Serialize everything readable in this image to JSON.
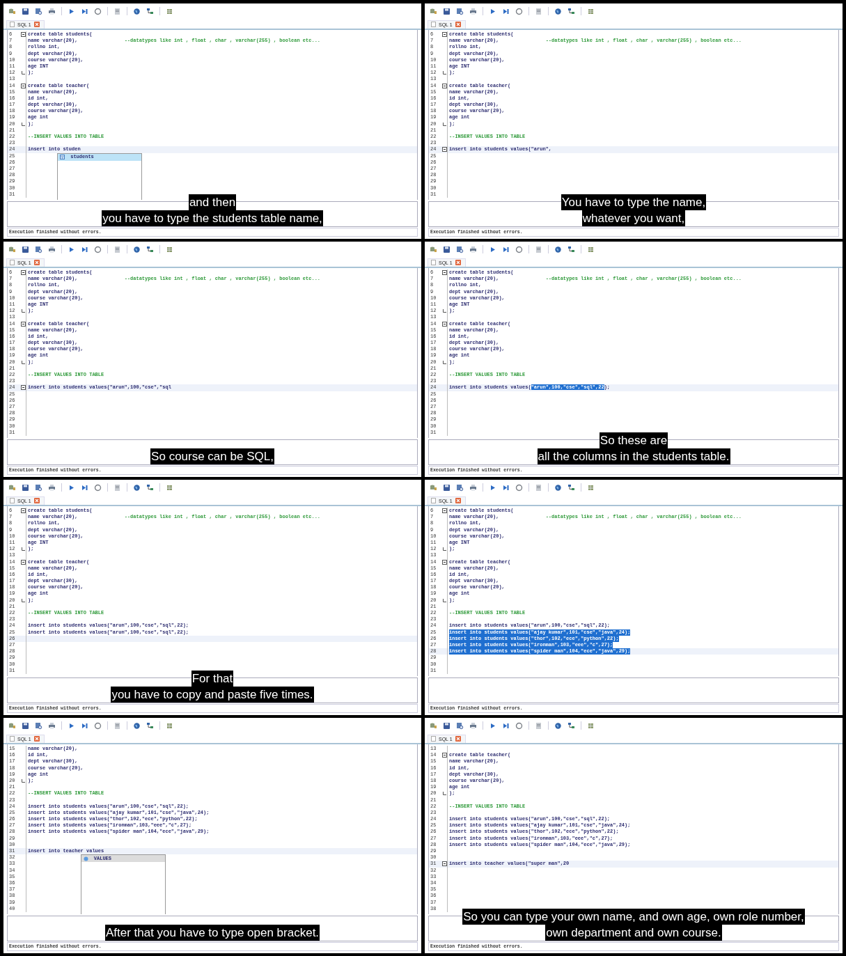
{
  "frames": [
    {
      "tab": {
        "label": "SQL 1",
        "selected": true
      },
      "lines": [
        {
          "no": "6",
          "kind": "code",
          "text": "create table students(",
          "fold_start": true
        },
        {
          "no": "7",
          "kind": "code",
          "text": "name varchar(20),",
          "comment": "--datatypes like int , float , char , varchar(255) , boolean etc..."
        },
        {
          "no": "8",
          "kind": "code",
          "text": "rollno int,"
        },
        {
          "no": "9",
          "kind": "code",
          "text": "dept varchar(20),"
        },
        {
          "no": "10",
          "kind": "code",
          "text": "course varchar(20),"
        },
        {
          "no": "11",
          "kind": "code",
          "text": "age INT"
        },
        {
          "no": "12",
          "kind": "code",
          "text": ");",
          "fold_end": true
        },
        {
          "no": "13"
        },
        {
          "no": "14",
          "kind": "code",
          "text": "create table teacher(",
          "fold_start": true
        },
        {
          "no": "15",
          "kind": "code",
          "text": "name varchar(20),"
        },
        {
          "no": "16",
          "kind": "code",
          "text": "id int,"
        },
        {
          "no": "17",
          "kind": "code",
          "text": "dept varchar(30),"
        },
        {
          "no": "18",
          "kind": "code",
          "text": "course varchar(20),"
        },
        {
          "no": "19",
          "kind": "code",
          "text": "age int"
        },
        {
          "no": "20",
          "kind": "code",
          "text": ");",
          "fold_end": true
        },
        {
          "no": "21"
        },
        {
          "no": "22",
          "kind": "comment",
          "text": "--INSERT VALUES INTO TABLE"
        },
        {
          "no": "23"
        },
        {
          "no": "24",
          "kind": "code",
          "text": "insert into studen",
          "current": true,
          "popup": {
            "items": [
              {
                "label": "students",
                "kind": "table",
                "selected": true
              }
            ]
          }
        },
        {
          "no": "25"
        },
        {
          "no": "26"
        },
        {
          "no": "27"
        },
        {
          "no": "28"
        },
        {
          "no": "29"
        },
        {
          "no": "30"
        },
        {
          "no": "31"
        }
      ],
      "subtitle": [
        "and then",
        "you have to type the students table name,"
      ],
      "status": "Execution finished without errors."
    },
    {
      "tab": {
        "label": "SQL 1",
        "selected": true
      },
      "lines": [
        {
          "no": "6",
          "kind": "code",
          "text": "create table students(",
          "fold_start": true
        },
        {
          "no": "7",
          "kind": "code",
          "text": "name varchar(20),",
          "comment": "--datatypes like int , float , char , varchar(255) , boolean etc..."
        },
        {
          "no": "8",
          "kind": "code",
          "text": "rollno int,"
        },
        {
          "no": "9",
          "kind": "code",
          "text": "dept varchar(20),"
        },
        {
          "no": "10",
          "kind": "code",
          "text": "course varchar(20),"
        },
        {
          "no": "11",
          "kind": "code",
          "text": "age INT"
        },
        {
          "no": "12",
          "kind": "code",
          "text": ");",
          "fold_end": true
        },
        {
          "no": "13"
        },
        {
          "no": "14",
          "kind": "code",
          "text": "create table teacher(",
          "fold_start": true
        },
        {
          "no": "15",
          "kind": "code",
          "text": "name varchar(20),"
        },
        {
          "no": "16",
          "kind": "code",
          "text": "id int,"
        },
        {
          "no": "17",
          "kind": "code",
          "text": "dept varchar(30),"
        },
        {
          "no": "18",
          "kind": "code",
          "text": "course varchar(20),"
        },
        {
          "no": "19",
          "kind": "code",
          "text": "age int"
        },
        {
          "no": "20",
          "kind": "code",
          "text": ");",
          "fold_end": true
        },
        {
          "no": "21"
        },
        {
          "no": "22",
          "kind": "comment",
          "text": "--INSERT VALUES INTO TABLE"
        },
        {
          "no": "23"
        },
        {
          "no": "24",
          "kind": "code",
          "text": "insert into students values(\"arun\",",
          "fold_start": true,
          "current": true
        },
        {
          "no": "25"
        },
        {
          "no": "26"
        },
        {
          "no": "27"
        },
        {
          "no": "28"
        },
        {
          "no": "29"
        },
        {
          "no": "30"
        },
        {
          "no": "31"
        }
      ],
      "subtitle": [
        "You have to type the name,",
        "whatever you want,"
      ],
      "status": "Execution finished without errors."
    },
    {
      "tab": {
        "label": "SQL 1",
        "selected": true
      },
      "lines": [
        {
          "no": "6",
          "kind": "code",
          "text": "create table students(",
          "fold_start": true
        },
        {
          "no": "7",
          "kind": "code",
          "text": "name varchar(20),",
          "comment": "--datatypes like int , float , char , varchar(255) , boolean etc..."
        },
        {
          "no": "8",
          "kind": "code",
          "text": "rollno int,"
        },
        {
          "no": "9",
          "kind": "code",
          "text": "dept varchar(20),"
        },
        {
          "no": "10",
          "kind": "code",
          "text": "course varchar(20),"
        },
        {
          "no": "11",
          "kind": "code",
          "text": "age INT"
        },
        {
          "no": "12",
          "kind": "code",
          "text": ");",
          "fold_end": true
        },
        {
          "no": "13"
        },
        {
          "no": "14",
          "kind": "code",
          "text": "create table teacher(",
          "fold_start": true
        },
        {
          "no": "15",
          "kind": "code",
          "text": "name varchar(20),"
        },
        {
          "no": "16",
          "kind": "code",
          "text": "id int,"
        },
        {
          "no": "17",
          "kind": "code",
          "text": "dept varchar(30),"
        },
        {
          "no": "18",
          "kind": "code",
          "text": "course varchar(20),"
        },
        {
          "no": "19",
          "kind": "code",
          "text": "age int"
        },
        {
          "no": "20",
          "kind": "code",
          "text": ");",
          "fold_end": true
        },
        {
          "no": "21"
        },
        {
          "no": "22",
          "kind": "comment",
          "text": "--INSERT VALUES INTO TABLE"
        },
        {
          "no": "23"
        },
        {
          "no": "24",
          "kind": "code",
          "text": "insert into students values(\"arun\",100,\"cse\",\"sql",
          "fold_start": true,
          "current": true
        },
        {
          "no": "25"
        },
        {
          "no": "26"
        },
        {
          "no": "27"
        },
        {
          "no": "28"
        },
        {
          "no": "29"
        },
        {
          "no": "30"
        },
        {
          "no": "31"
        }
      ],
      "subtitle": [
        "So course can be SQL,"
      ],
      "status": "Execution finished without errors."
    },
    {
      "tab": {
        "label": "SQL 1",
        "selected": true
      },
      "lines": [
        {
          "no": "6",
          "kind": "code",
          "text": "create table students(",
          "fold_start": true
        },
        {
          "no": "7",
          "kind": "code",
          "text": "name varchar(20),",
          "comment": "--datatypes like int , float , char , varchar(255) , boolean etc..."
        },
        {
          "no": "8",
          "kind": "code",
          "text": "rollno int,"
        },
        {
          "no": "9",
          "kind": "code",
          "text": "dept varchar(20),"
        },
        {
          "no": "10",
          "kind": "code",
          "text": "course varchar(20),"
        },
        {
          "no": "11",
          "kind": "code",
          "text": "age INT"
        },
        {
          "no": "12",
          "kind": "code",
          "text": ");",
          "fold_end": true
        },
        {
          "no": "13"
        },
        {
          "no": "14",
          "kind": "code",
          "text": "create table teacher(",
          "fold_start": true
        },
        {
          "no": "15",
          "kind": "code",
          "text": "name varchar(20),"
        },
        {
          "no": "16",
          "kind": "code",
          "text": "id int,"
        },
        {
          "no": "17",
          "kind": "code",
          "text": "dept varchar(30),"
        },
        {
          "no": "18",
          "kind": "code",
          "text": "course varchar(20),"
        },
        {
          "no": "19",
          "kind": "code",
          "text": "age int"
        },
        {
          "no": "20",
          "kind": "code",
          "text": ");",
          "fold_end": true
        },
        {
          "no": "21"
        },
        {
          "no": "22",
          "kind": "comment",
          "text": "--INSERT VALUES INTO TABLE"
        },
        {
          "no": "23"
        },
        {
          "no": "24",
          "kind": "code",
          "text": "insert into students values(",
          "selection": "\"arun\",100,\"cse\",\"sql\",22",
          "rest": ");",
          "current": true
        },
        {
          "no": "25"
        },
        {
          "no": "26"
        },
        {
          "no": "27"
        },
        {
          "no": "28"
        },
        {
          "no": "29"
        },
        {
          "no": "30"
        },
        {
          "no": "31"
        }
      ],
      "subtitle": [
        "So these are",
        "all the columns in the students table."
      ],
      "status": "Execution finished without errors."
    },
    {
      "tab": {
        "label": "SQL 1",
        "selected": true
      },
      "lines": [
        {
          "no": "6",
          "kind": "code",
          "text": "create table students(",
          "fold_start": true
        },
        {
          "no": "7",
          "kind": "code",
          "text": "name varchar(20),",
          "comment": "--datatypes like int , float , char , varchar(255) , boolean etc..."
        },
        {
          "no": "8",
          "kind": "code",
          "text": "rollno int,"
        },
        {
          "no": "9",
          "kind": "code",
          "text": "dept varchar(20),"
        },
        {
          "no": "10",
          "kind": "code",
          "text": "course varchar(20),"
        },
        {
          "no": "11",
          "kind": "code",
          "text": "age INT"
        },
        {
          "no": "12",
          "kind": "code",
          "text": ");",
          "fold_end": true
        },
        {
          "no": "13"
        },
        {
          "no": "14",
          "kind": "code",
          "text": "create table teacher(",
          "fold_start": true
        },
        {
          "no": "15",
          "kind": "code",
          "text": "name varchar(20),"
        },
        {
          "no": "16",
          "kind": "code",
          "text": "id int,"
        },
        {
          "no": "17",
          "kind": "code",
          "text": "dept varchar(30),"
        },
        {
          "no": "18",
          "kind": "code",
          "text": "course varchar(20),"
        },
        {
          "no": "19",
          "kind": "code",
          "text": "age int"
        },
        {
          "no": "20",
          "kind": "code",
          "text": ");",
          "fold_end": true
        },
        {
          "no": "21"
        },
        {
          "no": "22",
          "kind": "comment",
          "text": "--INSERT VALUES INTO TABLE"
        },
        {
          "no": "23"
        },
        {
          "no": "24",
          "kind": "code",
          "text": "insert into students values(\"arun\",100,\"cse\",\"sql\",22);"
        },
        {
          "no": "25",
          "kind": "code",
          "text": "insert into students values(\"arun\",100,\"cse\",\"sql\",22);"
        },
        {
          "no": "26",
          "current": true
        },
        {
          "no": "27"
        },
        {
          "no": "28"
        },
        {
          "no": "29"
        },
        {
          "no": "30"
        },
        {
          "no": "31"
        }
      ],
      "subtitle": [
        "For that",
        "you have to copy and paste five times."
      ],
      "status": "Execution finished without errors."
    },
    {
      "tab": {
        "label": "SQL 1",
        "selected": true
      },
      "lines": [
        {
          "no": "6",
          "kind": "code",
          "text": "create table students(",
          "fold_start": true
        },
        {
          "no": "7",
          "kind": "code",
          "text": "name varchar(20),",
          "comment": "--datatypes like int , float , char , varchar(255) , boolean etc..."
        },
        {
          "no": "8",
          "kind": "code",
          "text": "rollno int,"
        },
        {
          "no": "9",
          "kind": "code",
          "text": "dept varchar(20),"
        },
        {
          "no": "10",
          "kind": "code",
          "text": "course varchar(20),"
        },
        {
          "no": "11",
          "kind": "code",
          "text": "age INT"
        },
        {
          "no": "12",
          "kind": "code",
          "text": ");",
          "fold_end": true
        },
        {
          "no": "13"
        },
        {
          "no": "14",
          "kind": "code",
          "text": "create table teacher(",
          "fold_start": true
        },
        {
          "no": "15",
          "kind": "code",
          "text": "name varchar(20),"
        },
        {
          "no": "16",
          "kind": "code",
          "text": "id int,"
        },
        {
          "no": "17",
          "kind": "code",
          "text": "dept varchar(30),"
        },
        {
          "no": "18",
          "kind": "code",
          "text": "course varchar(20),"
        },
        {
          "no": "19",
          "kind": "code",
          "text": "age int"
        },
        {
          "no": "20",
          "kind": "code",
          "text": ");",
          "fold_end": true
        },
        {
          "no": "21"
        },
        {
          "no": "22",
          "kind": "comment",
          "text": "--INSERT VALUES INTO TABLE"
        },
        {
          "no": "23"
        },
        {
          "no": "24",
          "kind": "code",
          "text": "insert into students values(\"arun\",100,\"cse\",\"sql\",22);"
        },
        {
          "no": "25",
          "kind": "code",
          "text": "insert into students values(\"ajay kumar\",101,\"cse\",\"java\",24);",
          "selected": true
        },
        {
          "no": "26",
          "kind": "code",
          "text": "insert into students values(\"thor\",102,\"ece\",\"python\",22);",
          "selected": true
        },
        {
          "no": "27",
          "kind": "code",
          "text": "insert into students values(\"ironman\",103,\"eee\",\"c\",27);",
          "selected": true
        },
        {
          "no": "28",
          "kind": "code",
          "text": "insert into students values(\"spider man\",104,\"ece\",\"java\",29);",
          "selected": true,
          "current": true
        },
        {
          "no": "29"
        },
        {
          "no": "30"
        },
        {
          "no": "31"
        }
      ],
      "status": "Execution finished without errors."
    },
    {
      "tab": {
        "label": "SQL 1",
        "selected": true
      },
      "lines": [
        {
          "no": "15",
          "kind": "code",
          "text": "name varchar(20),"
        },
        {
          "no": "16",
          "kind": "code",
          "text": "id int,"
        },
        {
          "no": "17",
          "kind": "code",
          "text": "dept varchar(30),"
        },
        {
          "no": "18",
          "kind": "code",
          "text": "course varchar(20),"
        },
        {
          "no": "19",
          "kind": "code",
          "text": "age int"
        },
        {
          "no": "20",
          "kind": "code",
          "text": ");",
          "fold_end": true
        },
        {
          "no": "21"
        },
        {
          "no": "22",
          "kind": "comment",
          "text": "--INSERT VALUES INTO TABLE"
        },
        {
          "no": "23"
        },
        {
          "no": "24",
          "kind": "code",
          "text": "insert into students values(\"arun\",100,\"cse\",\"sql\",22);"
        },
        {
          "no": "25",
          "kind": "code",
          "text": "insert into students values(\"ajay kumar\",101,\"cse\",\"java\",24);"
        },
        {
          "no": "26",
          "kind": "code",
          "text": "insert into students values(\"thor\",102,\"ece\",\"python\",22);"
        },
        {
          "no": "27",
          "kind": "code",
          "text": "insert into students values(\"ironman\",103,\"eee\",\"c\",27);"
        },
        {
          "no": "28",
          "kind": "code",
          "text": "insert into students values(\"spider man\",104,\"ece\",\"java\",29);"
        },
        {
          "no": "29"
        },
        {
          "no": "30"
        },
        {
          "no": "31",
          "kind": "code",
          "text": "insert into teacher values",
          "current": true,
          "popup": {
            "items": [
              {
                "label": "VALUES",
                "kind": "keyword",
                "selected": true
              }
            ]
          }
        },
        {
          "no": "32"
        },
        {
          "no": "33"
        },
        {
          "no": "34"
        },
        {
          "no": "35"
        },
        {
          "no": "36"
        },
        {
          "no": "37"
        },
        {
          "no": "38"
        },
        {
          "no": "39"
        },
        {
          "no": "40"
        }
      ],
      "subtitle": [
        "After that you have to type open bracket."
      ],
      "status": "Execution finished without errors."
    },
    {
      "tab": {
        "label": "SQL 1",
        "selected": true
      },
      "lines": [
        {
          "no": "13"
        },
        {
          "no": "14",
          "kind": "code",
          "text": "create table teacher(",
          "fold_start": true
        },
        {
          "no": "15",
          "kind": "code",
          "text": "name varchar(20),"
        },
        {
          "no": "16",
          "kind": "code",
          "text": "id int,"
        },
        {
          "no": "17",
          "kind": "code",
          "text": "dept varchar(30),"
        },
        {
          "no": "18",
          "kind": "code",
          "text": "course varchar(20),"
        },
        {
          "no": "19",
          "kind": "code",
          "text": "age int"
        },
        {
          "no": "20",
          "kind": "code",
          "text": ");",
          "fold_end": true
        },
        {
          "no": "21"
        },
        {
          "no": "22",
          "kind": "comment",
          "text": "--INSERT VALUES INTO TABLE"
        },
        {
          "no": "23"
        },
        {
          "no": "24",
          "kind": "code",
          "text": "insert into students values(\"arun\",100,\"cse\",\"sql\",22);"
        },
        {
          "no": "25",
          "kind": "code",
          "text": "insert into students values(\"ajay kumar\",101,\"cse\",\"java\",24);"
        },
        {
          "no": "26",
          "kind": "code",
          "text": "insert into students values(\"thor\",102,\"ece\",\"python\",22);"
        },
        {
          "no": "27",
          "kind": "code",
          "text": "insert into students values(\"ironman\",103,\"eee\",\"c\",27);"
        },
        {
          "no": "28",
          "kind": "code",
          "text": "insert into students values(\"spider man\",104,\"ece\",\"java\",29);"
        },
        {
          "no": "29"
        },
        {
          "no": "30"
        },
        {
          "no": "31",
          "kind": "code",
          "text": "insert into teacher values(\"super man\",20",
          "fold_start": true,
          "current": true
        },
        {
          "no": "32"
        },
        {
          "no": "33"
        },
        {
          "no": "34"
        },
        {
          "no": "35"
        },
        {
          "no": "36"
        },
        {
          "no": "37"
        },
        {
          "no": "38"
        }
      ],
      "subtitle": [
        "So you can type your own name, and own age, own role number,",
        "own department and own course."
      ],
      "status": "Execution finished without errors."
    }
  ]
}
